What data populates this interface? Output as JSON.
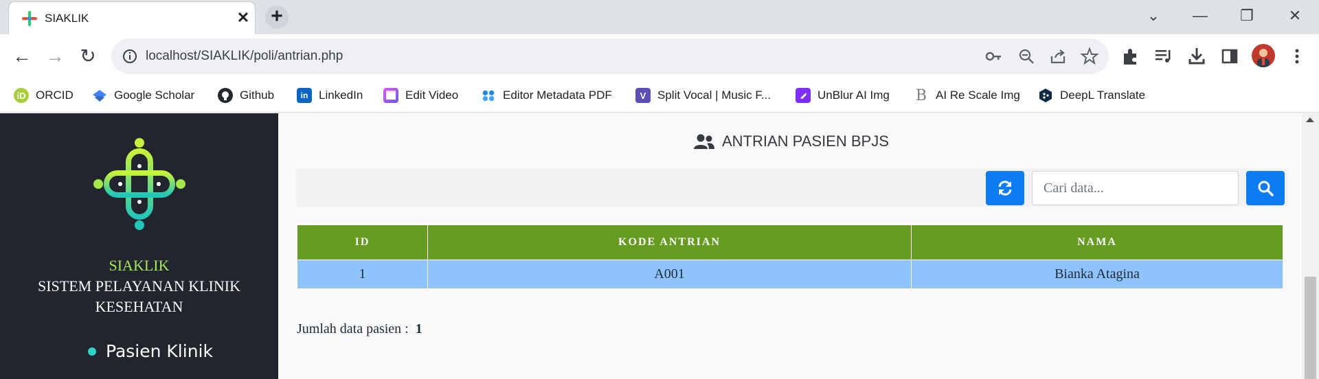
{
  "browser": {
    "tab_title": "SIAKLIK",
    "new_tab_label": "+",
    "tab_close_label": "✕",
    "url": "localhost/SIAKLIK/poli/antrian.php",
    "window_controls": {
      "chevron": "⌄",
      "minimize": "—",
      "restore": "❐",
      "close": "✕"
    },
    "nav": {
      "back": "←",
      "forward": "→",
      "reload": "↻"
    }
  },
  "bookmarks": [
    {
      "label": "ORCID",
      "icon": "orcid-icon",
      "color": "#a6ce39"
    },
    {
      "label": "Google Scholar",
      "icon": "scholar-icon",
      "color": "#4285f4"
    },
    {
      "label": "Github",
      "icon": "github-icon",
      "color": "#24292e"
    },
    {
      "label": "LinkedIn",
      "icon": "linkedin-icon",
      "color": "#0a66c2"
    },
    {
      "label": "Edit Video",
      "icon": "video-icon",
      "color": "#8e44ad"
    },
    {
      "label": "Editor Metadata PDF",
      "icon": "pdf-icon",
      "color": "#1e88e5"
    },
    {
      "label": "Split Vocal | Music F...",
      "icon": "vocal-icon",
      "color": "#5b4fb5"
    },
    {
      "label": "UnBlur AI Img",
      "icon": "unblur-icon",
      "color": "#7b2ff7"
    },
    {
      "label": "AI Re Scale Img",
      "icon": "rescale-icon",
      "color": "#7d7d7d"
    },
    {
      "label": "DeepL Translate",
      "icon": "deepl-icon",
      "color": "#0f2b46"
    }
  ],
  "sidebar": {
    "app_name": "SIAKLIK",
    "subtitle": "SISTEM PELAYANAN KLINIK KESEHATAN",
    "menu": [
      {
        "label": "Pasien Klinik"
      }
    ]
  },
  "main": {
    "title": "ANTRIAN PASIEN BPJS",
    "search": {
      "placeholder": "Cari data...",
      "value": ""
    },
    "table": {
      "headers": [
        "ID",
        "KODE ANTRIAN",
        "NAMA"
      ],
      "rows": [
        [
          "1",
          "A001",
          "Bianka Atagina"
        ]
      ]
    },
    "summary_label": "Jumlah data pasien :",
    "summary_count": "1"
  },
  "colors": {
    "accent": "#0d7cf2",
    "table_header": "#659b21",
    "table_row": "#8ec3fc",
    "sidebar_bg": "#22252e",
    "brand_green": "#a4e85a"
  }
}
